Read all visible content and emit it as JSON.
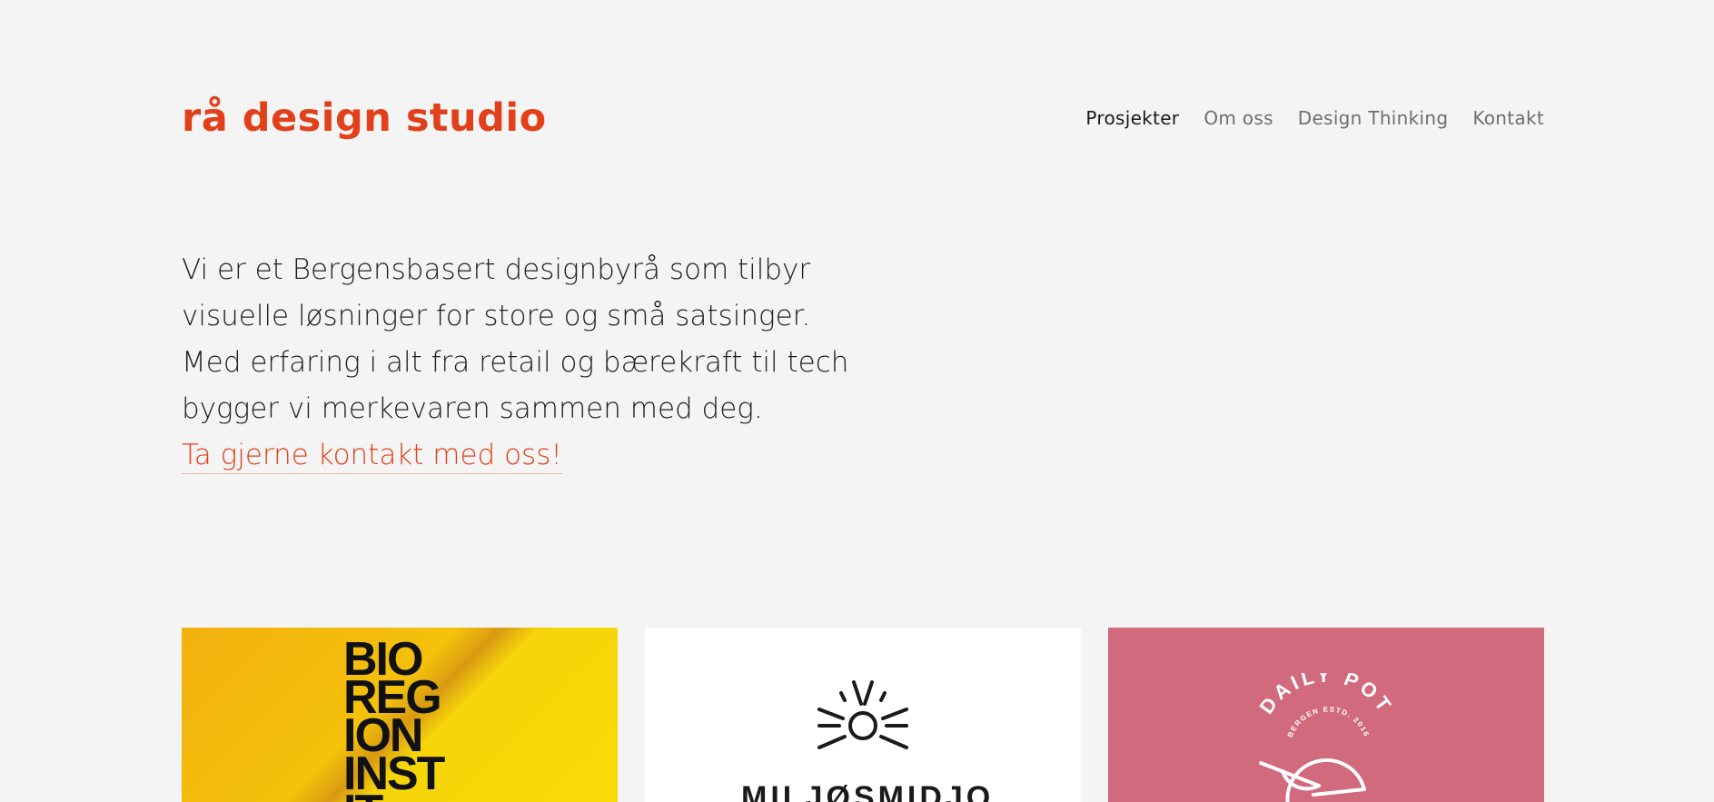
{
  "header": {
    "logo_text": "rå design studio",
    "nav": [
      {
        "label": "Prosjekter",
        "active": true
      },
      {
        "label": "Om oss",
        "active": false
      },
      {
        "label": "Design Thinking",
        "active": false
      },
      {
        "label": "Kontakt",
        "active": false
      }
    ]
  },
  "intro": {
    "lines": [
      "Vi er et Bergensbasert designbyrå som tilbyr",
      "visuelle løsninger for store og små satsinger.",
      "Med erfaring i alt fra retail og bærekraft til tech",
      "bygger vi merkevaren sammen med deg."
    ],
    "cta_label": "Ta gjerne kontakt med oss!"
  },
  "projects": [
    {
      "name": "bio-region-institutt",
      "text_lines": [
        "BIO",
        "REG",
        "ION",
        "INST",
        "IT"
      ]
    },
    {
      "name": "miljosmidjo",
      "text": "MILJØSMIDJO",
      "icon": "sun-rays-icon"
    },
    {
      "name": "daily-pot",
      "title": "DAILY POT",
      "subtitle": "BERGEN ESTD. 2016",
      "icon": "bowl-icon"
    }
  ],
  "colors": {
    "accent": "#e2401a",
    "background": "#f4f4f4",
    "text": "#1f1f1f",
    "nav_inactive": "#6e6e6e",
    "daily_pot_bg": "#d16a7c"
  }
}
